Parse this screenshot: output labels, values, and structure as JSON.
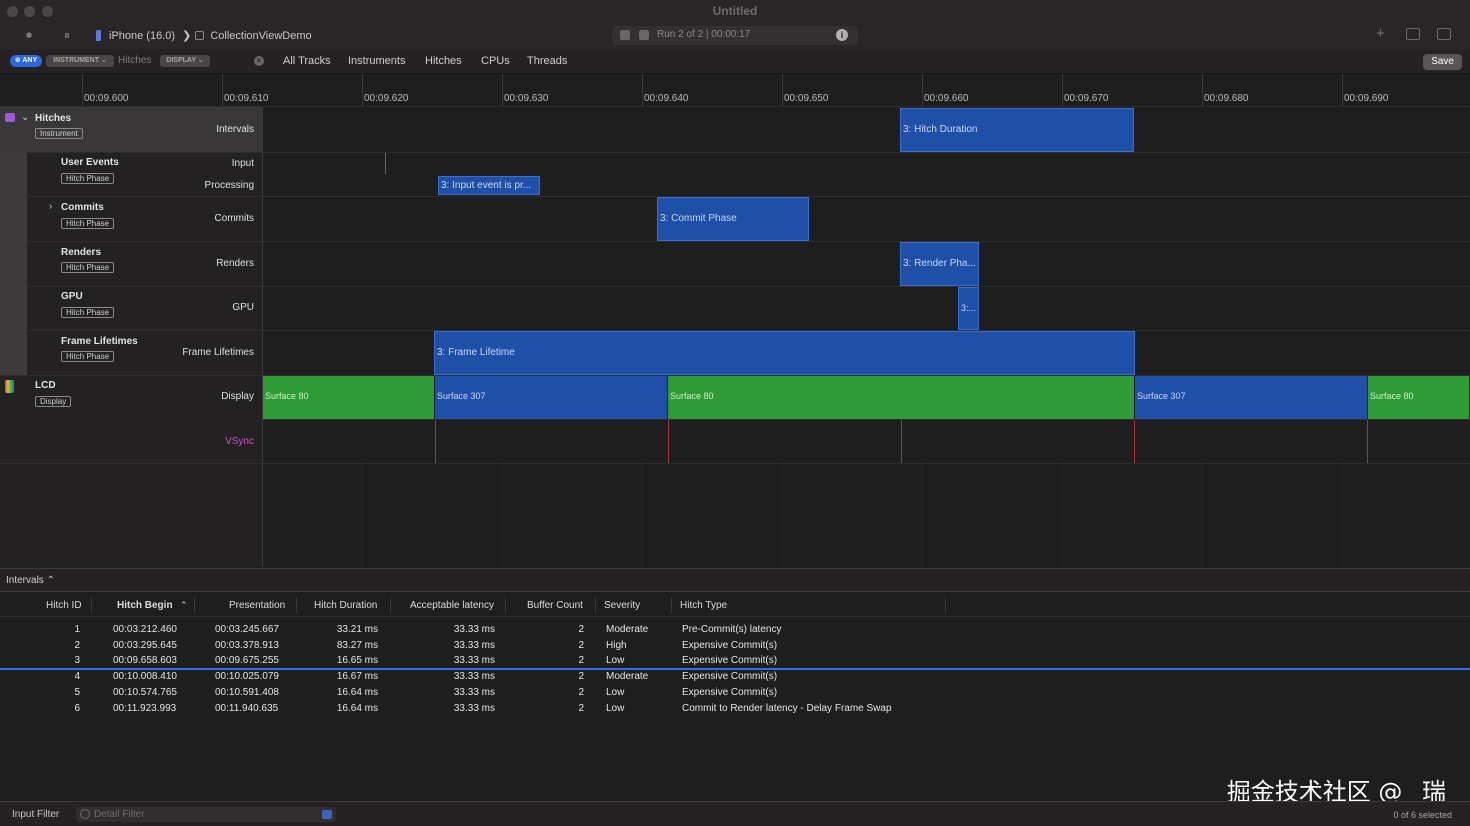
{
  "window": {
    "title": "Untitled"
  },
  "toolbar": {
    "device": "iPhone (16.0)",
    "app": "CollectionViewDemo",
    "run": "Run 2 of 2  |  00:00:17"
  },
  "filterbar": {
    "pill_any": "⊛ ANY",
    "pill_instrument": "INSTRUMENT ⌄",
    "pill_hitches": "Hitches",
    "pill_display": "DISPLAY ⌄",
    "tabs": [
      "All Tracks",
      "Instruments",
      "Hitches",
      "CPUs",
      "Threads"
    ],
    "save": "Save"
  },
  "ruler": {
    "labels": [
      "00:09.600",
      "00:09.610",
      "00:09.620",
      "00:09.630",
      "00:09.640",
      "00:09.650",
      "00:09.660",
      "00:09.670",
      "00:09.680",
      "00:09.690"
    ]
  },
  "tracks": {
    "hitches": {
      "title": "Hitches",
      "tag": "Instrument",
      "lane": "Intervals",
      "block": "3: Hitch Duration"
    },
    "user_events": {
      "title": "User Events",
      "tag": "Hitch Phase",
      "lane_input": "Input",
      "lane_processing": "Processing",
      "block": "3: Input event is pr..."
    },
    "commits": {
      "title": "Commits",
      "tag": "Hitch Phase",
      "lane": "Commits",
      "block": "3: Commit Phase"
    },
    "renders": {
      "title": "Renders",
      "tag": "Hitch Phase",
      "lane": "Renders",
      "block": "3: Render Pha..."
    },
    "gpu": {
      "title": "GPU",
      "tag": "Hitch Phase",
      "lane": "GPU",
      "block": "3:..."
    },
    "frame_lifetimes": {
      "title": "Frame Lifetimes",
      "tag": "Hitch Phase",
      "lane": "Frame Lifetimes",
      "block": "3: Frame Lifetime"
    },
    "lcd": {
      "title": "LCD",
      "tag": "Display",
      "lane": "Display",
      "vsync": "VSync",
      "surfaces": [
        "Surface 80",
        "Surface 307",
        "Surface 80",
        "Surface 307",
        "Surface 80"
      ]
    }
  },
  "detail": {
    "selector": "Intervals ⌃",
    "columns": [
      "Hitch ID",
      "Hitch Begin",
      "Presentation",
      "Hitch Duration",
      "Acceptable latency",
      "Buffer Count",
      "Severity",
      "Hitch Type"
    ],
    "sort_indicator": "⌃",
    "rows": [
      {
        "id": "1",
        "begin": "00:03.212.460",
        "presentation": "00:03.245.667",
        "duration": "33.21 ms",
        "latency": "33.33 ms",
        "buffers": "2",
        "severity": "Moderate",
        "type": "Pre-Commit(s) latency"
      },
      {
        "id": "2",
        "begin": "00:03.295.645",
        "presentation": "00:03.378.913",
        "duration": "83.27 ms",
        "latency": "33.33 ms",
        "buffers": "2",
        "severity": "High",
        "type": "Expensive Commit(s)"
      },
      {
        "id": "3",
        "begin": "00:09.658.603",
        "presentation": "00:09.675.255",
        "duration": "16.65 ms",
        "latency": "33.33 ms",
        "buffers": "2",
        "severity": "Low",
        "type": "Expensive Commit(s)"
      },
      {
        "id": "4",
        "begin": "00:10.008.410",
        "presentation": "00:10.025.079",
        "duration": "16.67 ms",
        "latency": "33.33 ms",
        "buffers": "2",
        "severity": "Moderate",
        "type": "Expensive Commit(s)"
      },
      {
        "id": "5",
        "begin": "00:10.574.765",
        "presentation": "00:10.591.408",
        "duration": "16.64 ms",
        "latency": "33.33 ms",
        "buffers": "2",
        "severity": "Low",
        "type": "Expensive Commit(s)"
      },
      {
        "id": "6",
        "begin": "00:11.923.993",
        "presentation": "00:11.940.635",
        "duration": "16.64 ms",
        "latency": "33.33 ms",
        "buffers": "2",
        "severity": "Low",
        "type": "Commit to Render latency - Delay Frame Swap"
      }
    ]
  },
  "bottombar": {
    "input_filter": "Input Filter",
    "detail_filter_placeholder": "Detail Filter",
    "selection": "0 of 6 selected"
  },
  "watermark": "掘金技术社区 @ _瑞",
  "colors": {
    "interval_blue": "#1f4fa6",
    "surface_green": "#2f9a38",
    "vsync_label": "#d14bd6",
    "selection_blue": "#2f6fe5"
  }
}
